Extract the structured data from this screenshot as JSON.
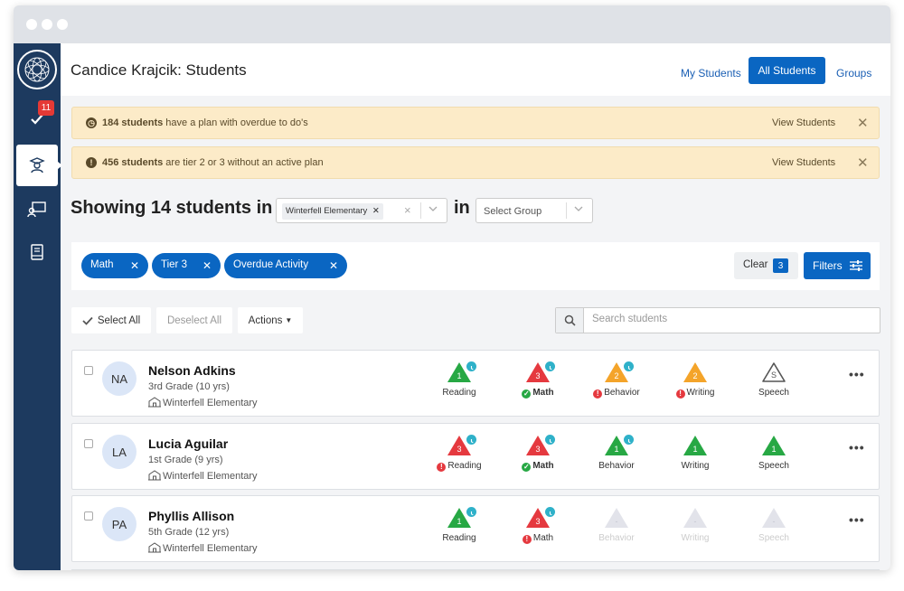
{
  "header": {
    "title": "Candice Krajcik: Students",
    "nav": [
      "My Students",
      "All Students",
      "Groups"
    ]
  },
  "sidebar": {
    "notification_count": "11"
  },
  "alerts": [
    {
      "bold": "184 students",
      "text": " have a plan with overdue to do's",
      "action": "View Students"
    },
    {
      "bold": "456 students",
      "text": " are tier 2 or 3 without an active plan",
      "action": "View Students"
    }
  ],
  "showing": {
    "text": "Showing 14 students in",
    "in": "in",
    "school": "Winterfell Elementary",
    "group_placeholder": "Select Group"
  },
  "filters": {
    "chips": [
      "Math",
      "Tier 3",
      "Overdue Activity"
    ],
    "clear_label": "Clear",
    "clear_count": "3",
    "filters_label": "Filters"
  },
  "toolbar": {
    "select_all": "Select All",
    "deselect_all": "Deselect All",
    "actions": "Actions",
    "search_placeholder": "Search students"
  },
  "colors": {
    "green": "#27a844",
    "red": "#e5393f",
    "orange": "#f4a42a",
    "gray": "#e2e3ea",
    "blue": "#0a66c2",
    "clock": "#2fb1c9"
  },
  "students": [
    {
      "initials": "NA",
      "name": "Nelson Adkins",
      "grade": "3rd Grade (10 yrs)",
      "school": "Winterfell Elementary",
      "subjects": [
        {
          "name": "Reading",
          "tier": "1",
          "color": "green",
          "clock": true,
          "status": "none"
        },
        {
          "name": "Math",
          "tier": "3",
          "color": "red",
          "clock": true,
          "status": "ok"
        },
        {
          "name": "Behavior",
          "tier": "2",
          "color": "orange",
          "clock": true,
          "status": "alert"
        },
        {
          "name": "Writing",
          "tier": "2",
          "color": "orange",
          "clock": false,
          "status": "alert"
        },
        {
          "name": "Speech",
          "tier": "S",
          "color": "outline",
          "clock": false,
          "status": "none"
        }
      ]
    },
    {
      "initials": "LA",
      "name": "Lucia Aguilar",
      "grade": "1st Grade (9 yrs)",
      "school": "Winterfell Elementary",
      "subjects": [
        {
          "name": "Reading",
          "tier": "3",
          "color": "red",
          "clock": true,
          "status": "alert"
        },
        {
          "name": "Math",
          "tier": "3",
          "color": "red",
          "clock": true,
          "status": "ok"
        },
        {
          "name": "Behavior",
          "tier": "1",
          "color": "green",
          "clock": true,
          "status": "none"
        },
        {
          "name": "Writing",
          "tier": "1",
          "color": "green",
          "clock": false,
          "status": "none"
        },
        {
          "name": "Speech",
          "tier": "1",
          "color": "green",
          "clock": false,
          "status": "none"
        }
      ]
    },
    {
      "initials": "PA",
      "name": "Phyllis Allison",
      "grade": "5th Grade (12 yrs)",
      "school": "Winterfell Elementary",
      "subjects": [
        {
          "name": "Reading",
          "tier": "1",
          "color": "green",
          "clock": true,
          "status": "none"
        },
        {
          "name": "Math",
          "tier": "3",
          "color": "red",
          "clock": true,
          "status": "alert"
        },
        {
          "name": "Behavior",
          "tier": "-",
          "color": "gray",
          "clock": false,
          "status": "dim"
        },
        {
          "name": "Writing",
          "tier": "-",
          "color": "gray",
          "clock": false,
          "status": "dim"
        },
        {
          "name": "Speech",
          "tier": "-",
          "color": "gray",
          "clock": false,
          "status": "dim"
        }
      ]
    }
  ]
}
